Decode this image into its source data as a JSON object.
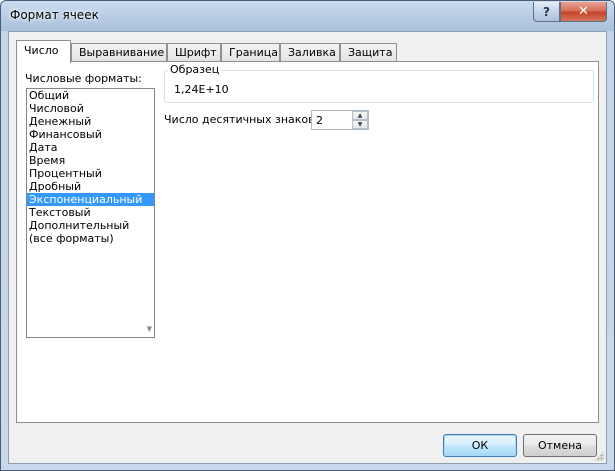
{
  "window": {
    "title": "Формат ячеек",
    "help_label": "?",
    "close_label": "✕"
  },
  "tabs": [
    {
      "label": "Число",
      "active": true
    },
    {
      "label": "Выравнивание",
      "active": false
    },
    {
      "label": "Шрифт",
      "active": false
    },
    {
      "label": "Граница",
      "active": false
    },
    {
      "label": "Заливка",
      "active": false
    },
    {
      "label": "Защита",
      "active": false
    }
  ],
  "formats": {
    "label": "Числовые форматы:",
    "items": [
      "Общий",
      "Числовой",
      "Денежный",
      "Финансовый",
      "Дата",
      "Время",
      "Процентный",
      "Дробный",
      "Экспоненциальный",
      "Текстовый",
      "Дополнительный",
      "(все форматы)"
    ],
    "selected": "Экспоненциальный"
  },
  "sample": {
    "legend": "Образец",
    "value": "1,24E+10"
  },
  "decimals": {
    "label": "Число десятичных знаков:",
    "value": "2"
  },
  "buttons": {
    "ok": "ОК",
    "cancel": "Отмена"
  }
}
